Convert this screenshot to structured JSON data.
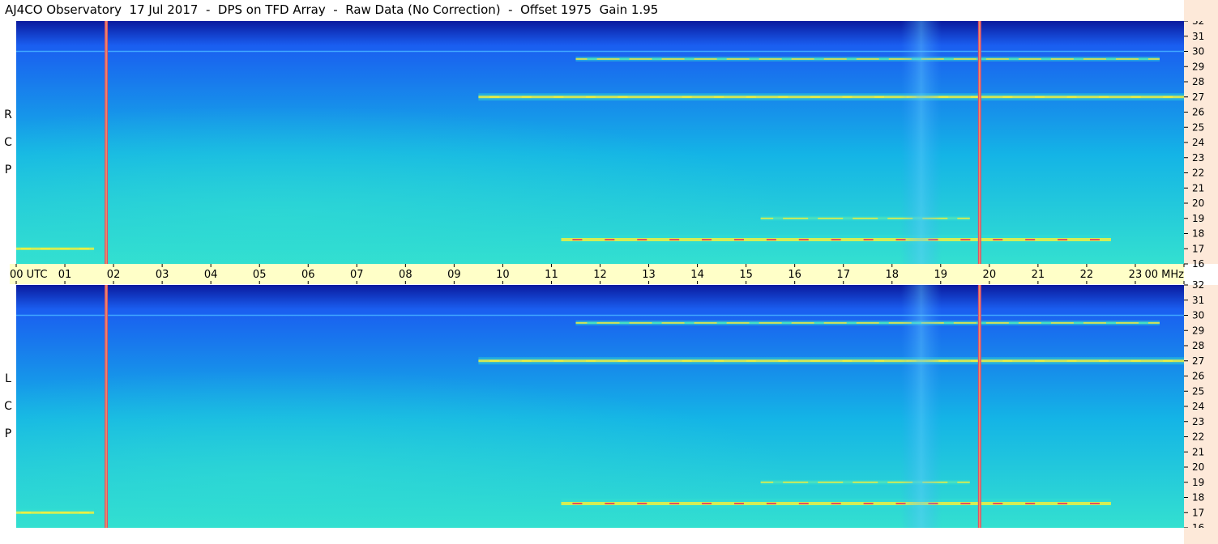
{
  "title": "AJ4CO Observatory  17 Jul 2017  -  DPS on TFD Array  -  Raw Data (No Correction)  -  Offset 1975  Gain 1.95",
  "polarizations": [
    {
      "id": "rcp",
      "letters": [
        "R",
        "C",
        "P"
      ]
    },
    {
      "id": "lcp",
      "letters": [
        "L",
        "C",
        "P"
      ]
    }
  ],
  "time_axis": {
    "ticks": [
      "00",
      "01",
      "02",
      "03",
      "04",
      "05",
      "06",
      "07",
      "08",
      "09",
      "10",
      "11",
      "12",
      "13",
      "14",
      "15",
      "16",
      "17",
      "18",
      "19",
      "20",
      "21",
      "22",
      "23",
      "00"
    ],
    "start_unit": "UTC",
    "end_unit": "MHz"
  },
  "freq_axis": {
    "ticks": [
      32,
      31,
      30,
      29,
      28,
      27,
      26,
      25,
      24,
      23,
      22,
      21,
      20,
      19,
      18,
      17,
      16
    ]
  },
  "colors": {
    "background_low": "#0a1a9e",
    "background_mid": "#1a5ef0",
    "background_high": "#14b4e6",
    "signal_cyan": "#33e0d0",
    "signal_yellow": "#f0f040",
    "signal_red": "#e04060",
    "marker": "#e0506a",
    "freq_panel": "#fde9d9",
    "time_panel": "#ffffc8"
  },
  "chart_data": {
    "type": "heatmap",
    "xlabel": "UTC",
    "ylabel": "MHz",
    "xlim": [
      0,
      24
    ],
    "ylim": [
      16,
      32
    ],
    "panels": [
      "RCP",
      "LCP"
    ],
    "marker_lines_utc": [
      1.85,
      19.8
    ],
    "features": [
      {
        "name": "band_27",
        "freq_mhz": 27.0,
        "utc_start": 9.5,
        "utc_end": 24,
        "intensity": "high"
      },
      {
        "name": "band_17_5",
        "freq_mhz": 17.6,
        "utc_start": 11.2,
        "utc_end": 22.5,
        "intensity": "very high"
      },
      {
        "name": "band_17",
        "freq_mhz": 17.0,
        "utc_start": 0,
        "utc_end": 1.6,
        "intensity": "high"
      },
      {
        "name": "band_29_5",
        "freq_mhz": 29.5,
        "utc_start": 11.5,
        "utc_end": 23.5,
        "intensity": "medium"
      },
      {
        "name": "band_19",
        "freq_mhz": 19.0,
        "utc_start": 15.3,
        "utc_end": 19.6,
        "intensity": "medium"
      },
      {
        "name": "broadband_vertical",
        "utc": 18.6,
        "freq_range": [
          16,
          32
        ],
        "intensity": "medium"
      }
    ]
  }
}
